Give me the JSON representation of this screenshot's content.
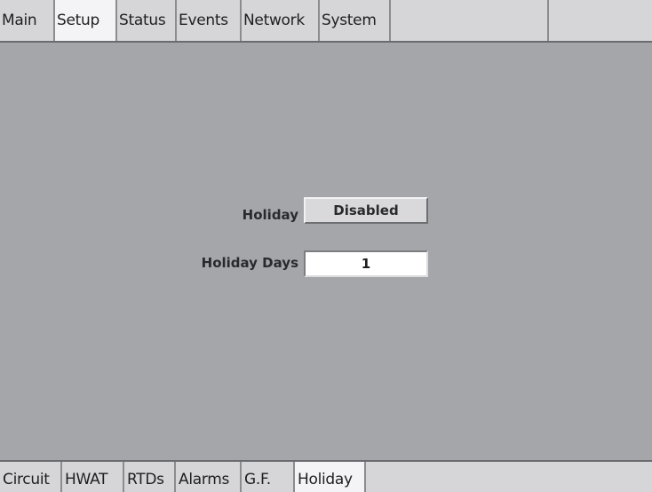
{
  "top_tabs": [
    {
      "label": "Main",
      "active": false
    },
    {
      "label": "Setup",
      "active": true
    },
    {
      "label": "Status",
      "active": false
    },
    {
      "label": "Events",
      "active": false
    },
    {
      "label": "Network",
      "active": false
    },
    {
      "label": "System",
      "active": false
    }
  ],
  "main": {
    "holiday_label": "Holiday",
    "holiday_value": "Disabled",
    "holiday_days_label": "Holiday Days",
    "holiday_days_value": "1"
  },
  "bottom_tabs": [
    {
      "label": "Circuit",
      "active": false
    },
    {
      "label": "HWAT",
      "active": false
    },
    {
      "label": "RTDs",
      "active": false
    },
    {
      "label": "Alarms",
      "active": false
    },
    {
      "label": "G.F.",
      "active": false
    },
    {
      "label": "Holiday",
      "active": true
    }
  ]
}
